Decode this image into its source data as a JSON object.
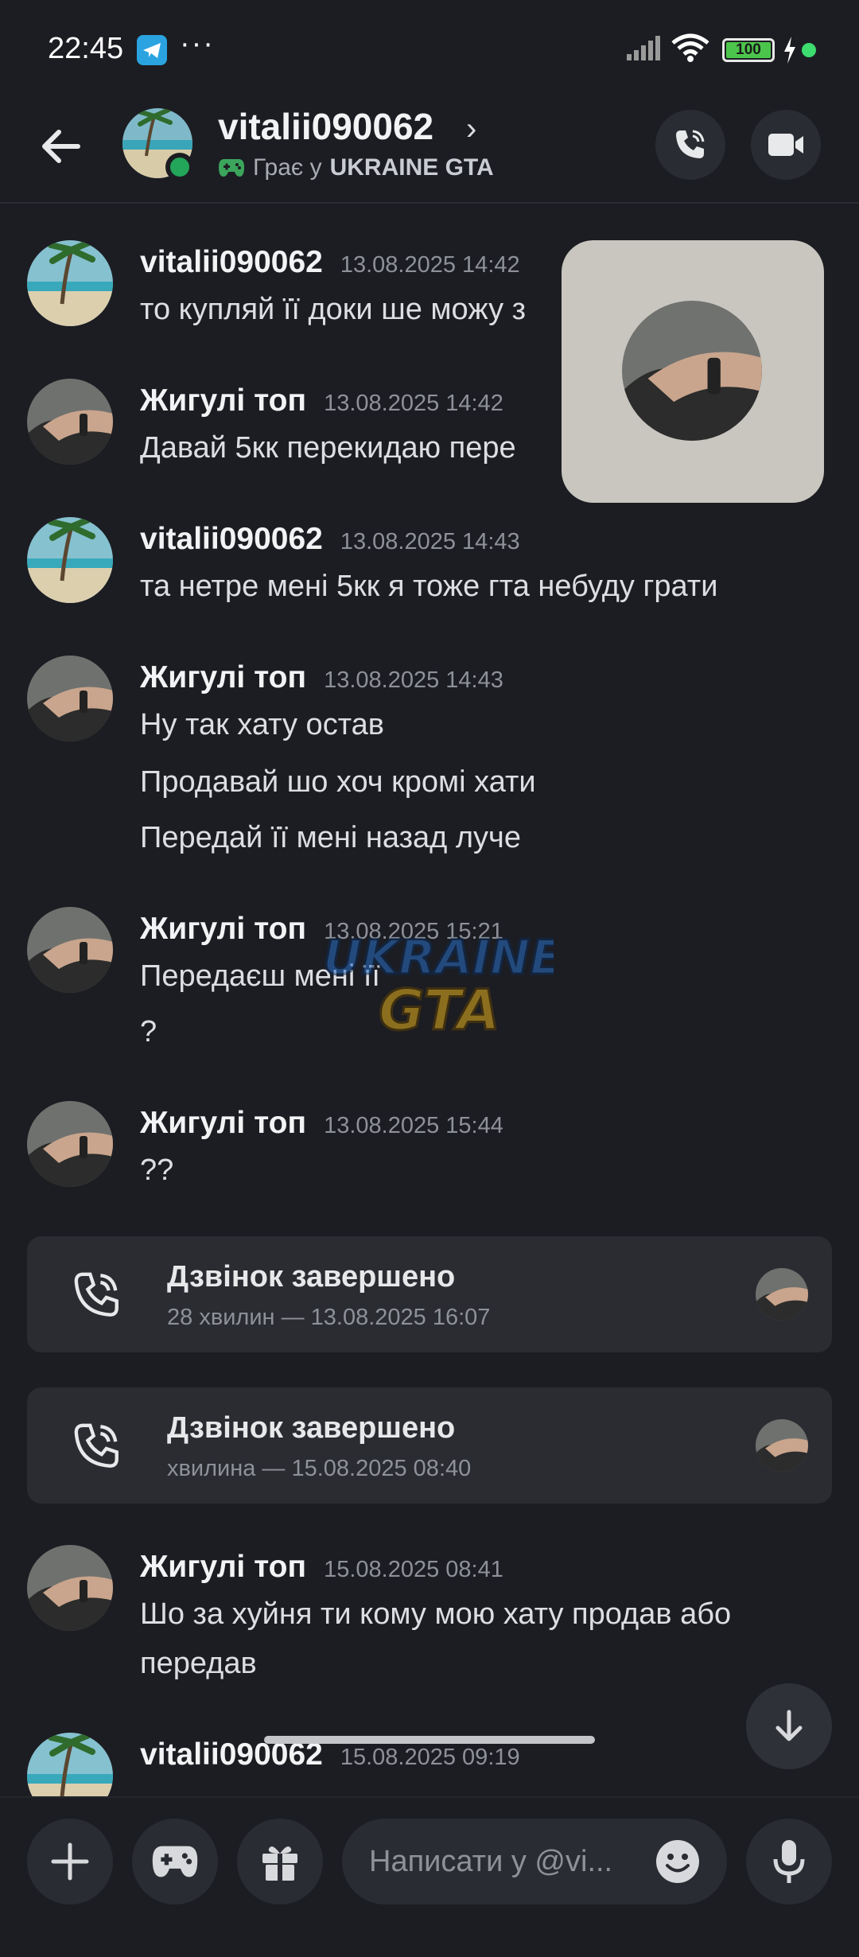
{
  "status_bar": {
    "time": "22:45",
    "more": "···",
    "battery": "100",
    "icons": [
      "telegram-icon",
      "signal-icon",
      "wifi-icon",
      "battery-icon",
      "charging-icon"
    ]
  },
  "header": {
    "name": "vitalii090062",
    "chevron": "›",
    "status_prefix": "Грає у",
    "status_game": "UKRAINE GTA"
  },
  "messages": [
    {
      "author": "vitalii090062",
      "time": "13.08.2025 14:42",
      "lines": [
        "то купляй її доки ше можу з"
      ]
    },
    {
      "author": "Жигулі топ",
      "time": "13.08.2025 14:42",
      "lines": [
        "Давай 5кк перекидаю пере"
      ]
    },
    {
      "author": "vitalii090062",
      "time": "13.08.2025 14:43",
      "lines": [
        "та нетре мені 5кк я тоже гта небуду грати"
      ]
    },
    {
      "author": "Жигулі топ",
      "time": "13.08.2025 14:43",
      "lines": [
        "Ну так хату остав",
        "Продавай шо хоч кромі хати",
        "Передай її мені назад луче"
      ]
    },
    {
      "author": "Жигулі топ",
      "time": "13.08.2025 15:21",
      "lines": [
        "Передаєш мені її",
        "?"
      ]
    },
    {
      "author": "Жигулі топ",
      "time": "13.08.2025 15:44",
      "lines": [
        "??"
      ]
    },
    {
      "author": "Жигулі топ",
      "time": "15.08.2025 08:41",
      "lines": [
        "Шо за хуйня ти кому мою хату продав або",
        "передав"
      ]
    },
    {
      "author": "vitalii090062",
      "time": "15.08.2025 09:19",
      "lines": []
    }
  ],
  "calls": [
    {
      "title": "Дзвінок завершено",
      "subtitle": "28 хвилин — 13.08.2025 16:07"
    },
    {
      "title": "Дзвінок завершено",
      "subtitle": "хвилина — 15.08.2025 08:40"
    }
  ],
  "watermark": {
    "line1": "UKRAINE",
    "line2": "GTA"
  },
  "composer": {
    "placeholder": "Написати у @vi..."
  },
  "colors": {
    "background": "#1c1d22",
    "online": "#23a55a",
    "card": "#2a2c32"
  }
}
